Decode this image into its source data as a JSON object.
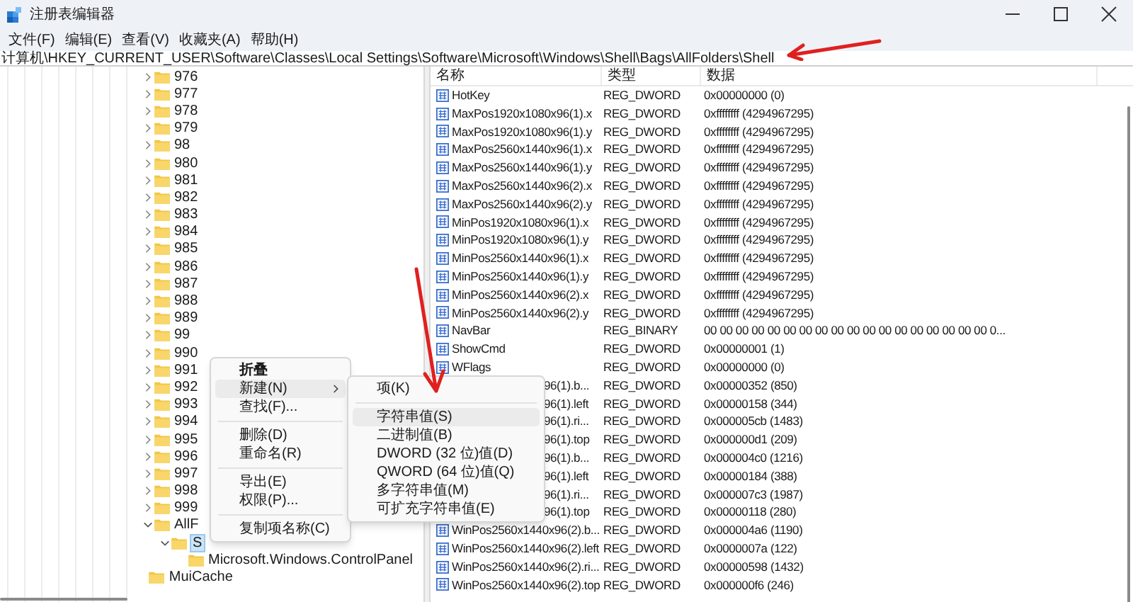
{
  "window": {
    "title": "注册表编辑器"
  },
  "menu": [
    "文件(F)",
    "编辑(E)",
    "查看(V)",
    "收藏夹(A)",
    "帮助(H)"
  ],
  "address": "计算机\\HKEY_CURRENT_USER\\Software\\Classes\\Local Settings\\Software\\Microsoft\\Windows\\Shell\\Bags\\AllFolders\\Shell",
  "tree": {
    "items": [
      {
        "children": [
          {
            "label": "976",
            "expanded": false
          },
          {
            "label": "977",
            "expanded": false
          },
          {
            "label": "978",
            "expanded": false
          },
          {
            "label": "979",
            "expanded": false
          },
          {
            "label": "98",
            "expanded": false
          },
          {
            "label": "980",
            "expanded": false
          },
          {
            "label": "981",
            "expanded": false
          },
          {
            "label": "982",
            "expanded": false
          },
          {
            "label": "983",
            "expanded": false
          },
          {
            "label": "984",
            "expanded": false
          },
          {
            "label": "985",
            "expanded": false
          },
          {
            "label": "986",
            "expanded": false
          },
          {
            "label": "987",
            "expanded": false
          },
          {
            "label": "988",
            "expanded": false
          },
          {
            "label": "989",
            "expanded": false
          },
          {
            "label": "99",
            "expanded": false
          },
          {
            "label": "990",
            "expanded": false
          },
          {
            "label": "991",
            "expanded": false
          },
          {
            "label": "992",
            "expanded": false
          },
          {
            "label": "993",
            "expanded": false
          },
          {
            "label": "994",
            "expanded": false
          },
          {
            "label": "995",
            "expanded": false
          },
          {
            "label": "996",
            "expanded": false
          },
          {
            "label": "997",
            "expanded": false
          },
          {
            "label": "998",
            "expanded": false
          },
          {
            "label": "999",
            "expanded": false
          },
          {
            "label": "AllF",
            "expanded": true,
            "children": [
              {
                "label": "S",
                "expanded": true,
                "selected": true,
                "children": [
                  {
                    "label": "Microsoft.Windows.ControlPanel"
                  }
                ]
              }
            ]
          }
        ]
      },
      {
        "label": "MuiCache"
      }
    ]
  },
  "table": {
    "columns": [
      "名称",
      "类型",
      "数据"
    ],
    "rows": [
      {
        "kind": "full",
        "name": "HotKey",
        "type": "REG_DWORD",
        "data": "0x00000000 (0)"
      },
      {
        "kind": "full",
        "name": "MaxPos1920x1080x96(1).x",
        "type": "REG_DWORD",
        "data": "0xffffffff (4294967295)"
      },
      {
        "kind": "full",
        "name": "MaxPos1920x1080x96(1).y",
        "type": "REG_DWORD",
        "data": "0xffffffff (4294967295)"
      },
      {
        "kind": "full",
        "name": "MaxPos2560x1440x96(1).x",
        "type": "REG_DWORD",
        "data": "0xffffffff (4294967295)"
      },
      {
        "kind": "full",
        "name": "MaxPos2560x1440x96(1).y",
        "type": "REG_DWORD",
        "data": "0xffffffff (4294967295)"
      },
      {
        "kind": "full",
        "name": "MaxPos2560x1440x96(2).x",
        "type": "REG_DWORD",
        "data": "0xffffffff (4294967295)"
      },
      {
        "kind": "full",
        "name": "MaxPos2560x1440x96(2).y",
        "type": "REG_DWORD",
        "data": "0xffffffff (4294967295)"
      },
      {
        "kind": "full",
        "name": "MinPos1920x1080x96(1).x",
        "type": "REG_DWORD",
        "data": "0xffffffff (4294967295)"
      },
      {
        "kind": "full",
        "name": "MinPos1920x1080x96(1).y",
        "type": "REG_DWORD",
        "data": "0xffffffff (4294967295)"
      },
      {
        "kind": "full",
        "name": "MinPos2560x1440x96(1).x",
        "type": "REG_DWORD",
        "data": "0xffffffff (4294967295)"
      },
      {
        "kind": "full",
        "name": "MinPos2560x1440x96(1).y",
        "type": "REG_DWORD",
        "data": "0xffffffff (4294967295)"
      },
      {
        "kind": "full",
        "name": "MinPos2560x1440x96(2).x",
        "type": "REG_DWORD",
        "data": "0xffffffff (4294967295)"
      },
      {
        "kind": "full",
        "name": "MinPos2560x1440x96(2).y",
        "type": "REG_DWORD",
        "data": "0xffffffff (4294967295)"
      },
      {
        "kind": "full",
        "name": "NavBar",
        "type": "REG_BINARY",
        "data": "00 00 00 00 00 00 00 00 00 00 00 00 00 00 00 00 00 00 0..."
      },
      {
        "kind": "full",
        "name": "ShowCmd",
        "type": "REG_DWORD",
        "data": "0x00000001 (1)"
      },
      {
        "kind": "full",
        "name": "WFlags",
        "type": "REG_DWORD",
        "data": "0x00000000 (0)"
      },
      {
        "kind": "partial",
        "name": "96(1).b...",
        "type": "REG_DWORD",
        "data": "0x00000352 (850)"
      },
      {
        "kind": "partial",
        "name": "96(1).left",
        "type": "REG_DWORD",
        "data": "0x00000158 (344)"
      },
      {
        "kind": "partial",
        "name": "96(1).ri...",
        "type": "REG_DWORD",
        "data": "0x000005cb (1483)"
      },
      {
        "kind": "partial",
        "name": "96(1).top",
        "type": "REG_DWORD",
        "data": "0x000000d1 (209)"
      },
      {
        "kind": "partial",
        "name": "96(1).b...",
        "type": "REG_DWORD",
        "data": "0x000004c0 (1216)"
      },
      {
        "kind": "partial",
        "name": "96(1).left",
        "type": "REG_DWORD",
        "data": "0x00000184 (388)"
      },
      {
        "kind": "partial",
        "name": "96(1).ri...",
        "type": "REG_DWORD",
        "data": "0x000007c3 (1987)"
      },
      {
        "kind": "partial",
        "name": "96(1).top",
        "type": "REG_DWORD",
        "data": "0x00000118 (280)"
      },
      {
        "kind": "full",
        "name": "WinPos2560x1440x96(2).b...",
        "type": "REG_DWORD",
        "data": "0x000004a6 (1190)"
      },
      {
        "kind": "full",
        "name": "WinPos2560x1440x96(2).left",
        "type": "REG_DWORD",
        "data": "0x0000007a (122)"
      },
      {
        "kind": "full",
        "name": "WinPos2560x1440x96(2).ri...",
        "type": "REG_DWORD",
        "data": "0x00000598 (1432)"
      },
      {
        "kind": "full",
        "name": "WinPos2560x1440x96(2).top",
        "type": "REG_DWORD",
        "data": "0x000000f6 (246)"
      }
    ]
  },
  "context_menu": [
    {
      "kind": "item",
      "label": "折叠",
      "bold": true,
      "selected": false
    },
    {
      "kind": "submenu",
      "label": "新建(N)",
      "bold": false,
      "selected": true
    },
    {
      "kind": "item",
      "label": "查找(F)...",
      "bold": false,
      "selected": false
    },
    {
      "kind": "separator"
    },
    {
      "kind": "item",
      "label": "删除(D)",
      "bold": false,
      "selected": false
    },
    {
      "kind": "item",
      "label": "重命名(R)",
      "bold": false,
      "selected": false
    },
    {
      "kind": "separator"
    },
    {
      "kind": "item",
      "label": "导出(E)",
      "bold": false,
      "selected": false
    },
    {
      "kind": "item",
      "label": "权限(P)...",
      "bold": false,
      "selected": false
    },
    {
      "kind": "separator"
    },
    {
      "kind": "item",
      "label": "复制项名称(C)",
      "bold": false,
      "selected": false
    }
  ],
  "submenu": [
    {
      "kind": "item",
      "label": "项(K)",
      "selected": false
    },
    {
      "kind": "separator"
    },
    {
      "kind": "item",
      "label": "字符串值(S)",
      "selected": true
    },
    {
      "kind": "item",
      "label": "二进制值(B)",
      "selected": false
    },
    {
      "kind": "item",
      "label": "DWORD (32 位)值(D)",
      "selected": false
    },
    {
      "kind": "item",
      "label": "QWORD (64 位)值(Q)",
      "selected": false
    },
    {
      "kind": "item",
      "label": "多字符串值(M)",
      "selected": false
    },
    {
      "kind": "item",
      "label": "可扩充字符串值(E)",
      "selected": false
    }
  ]
}
